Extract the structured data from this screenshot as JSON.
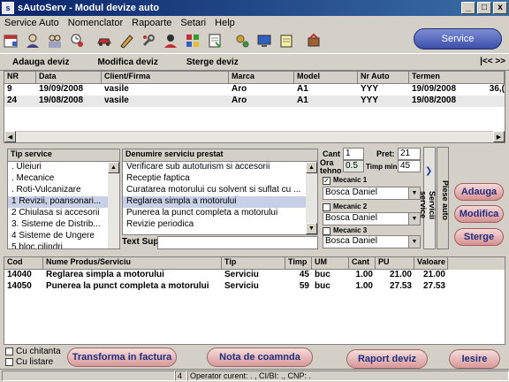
{
  "window": {
    "title": "sAutoServ - Modul devize auto",
    "min": "_",
    "max": "□",
    "close": "x"
  },
  "menu": [
    "Service Auto",
    "Nomenclator",
    "Rapoarte",
    "Setari",
    "Help"
  ],
  "toolbar_icons": [
    "calendar-icon",
    "person-icon",
    "group-icon",
    "clock-icon",
    "car-icon",
    "pen-icon",
    "wrench-icon",
    "person2-icon",
    "blocks-icon",
    "note-icon",
    "gears-icon",
    "monitor-icon",
    "notepad-icon",
    "exit-icon"
  ],
  "service_button": "Service",
  "actions": {
    "add": "Adauga deviz",
    "edit": "Modifica deviz",
    "delete": "Sterge deviz",
    "nav": "|<<  >>"
  },
  "deviz_table": {
    "headers": [
      "NR",
      "Data",
      "Client/Firma",
      "Marca",
      "Model",
      "Nr Auto",
      "Termen"
    ],
    "rows": [
      [
        "9",
        "19/09/2008",
        "vasile",
        "Aro",
        "A1",
        "YYY",
        "19/09/2008",
        "36,("
      ],
      [
        "24",
        "19/08/2008",
        "vasile",
        "Aro",
        "A1",
        "YYY",
        "19/08/2008",
        ""
      ]
    ]
  },
  "tip_service": {
    "header": "Tip service",
    "items": [
      " .  Uleiuri",
      " .  Mecanice",
      " .  Roti-Vulcanizare",
      "1 Revizii, poansonari...",
      "2 Chiulasa si accesorii",
      "3. Sisteme de Distrib...",
      "4 Sisteme de Ungere",
      "5 bloc cilindri"
    ],
    "selected": 3
  },
  "denumire": {
    "header": "Denumire serviciu prestat",
    "items": [
      "Verificare sub autoturism si accesorii",
      "Receptie faptica",
      "Curatarea motorului cu solvent si suflat cu ...",
      "Reglarea simpla a motorului",
      "Punerea la punct completa a motorului",
      "Revizie periodica"
    ],
    "selected": 3,
    "text_sup_label": "Text Sup"
  },
  "mecanic_panel": {
    "cant_label": "Cant",
    "cant_value": "1",
    "pret_label": "Pret:",
    "pret_value": "21",
    "ora_label": "Ora tehno",
    "ora_value": "0.5",
    "timp_label": "Timp min",
    "timp_value": "45",
    "mecanic1_label": "Mecanic 1",
    "mecanic1_checked": true,
    "mecanic1_value": "Bosca Daniel",
    "mecanic2_label": "Mecanic 2",
    "mecanic2_value": "Bosca Daniel",
    "mecanic3_label": "Mecanic 3",
    "mecanic3_value": "Bosca Daniel"
  },
  "vertical_tabs": {
    "servicii": "Servicii service",
    "piese": "Piese auto"
  },
  "side_buttons": {
    "add": "Adauga",
    "edit": "Modifica",
    "delete": "Sterge"
  },
  "products_table": {
    "headers": [
      "Cod",
      "Nume Produs/Serviciu",
      "Tip",
      "Timp",
      "UM",
      "Cant",
      "PU",
      "Valoare"
    ],
    "rows": [
      [
        "14040",
        "Reglarea simpla a motorului",
        "Serviciu",
        "45",
        "buc",
        "1.00",
        "21.00",
        "21.00"
      ],
      [
        "14050",
        "Punerea la punct completa a motorului",
        "Serviciu",
        "59",
        "buc",
        "1.00",
        "27.53",
        "27.53"
      ]
    ]
  },
  "options": {
    "chitanta": "Cu chitanta",
    "listare": "Cu listare"
  },
  "bottom_buttons": {
    "factura": "Transforma in factura",
    "comanda": "Nota de coamnda",
    "raport": "Raport deviz",
    "iesire": "Iesire"
  },
  "status": {
    "count": "4",
    "text": "Operator curent: . , CI/BI: ., CNP: ."
  }
}
